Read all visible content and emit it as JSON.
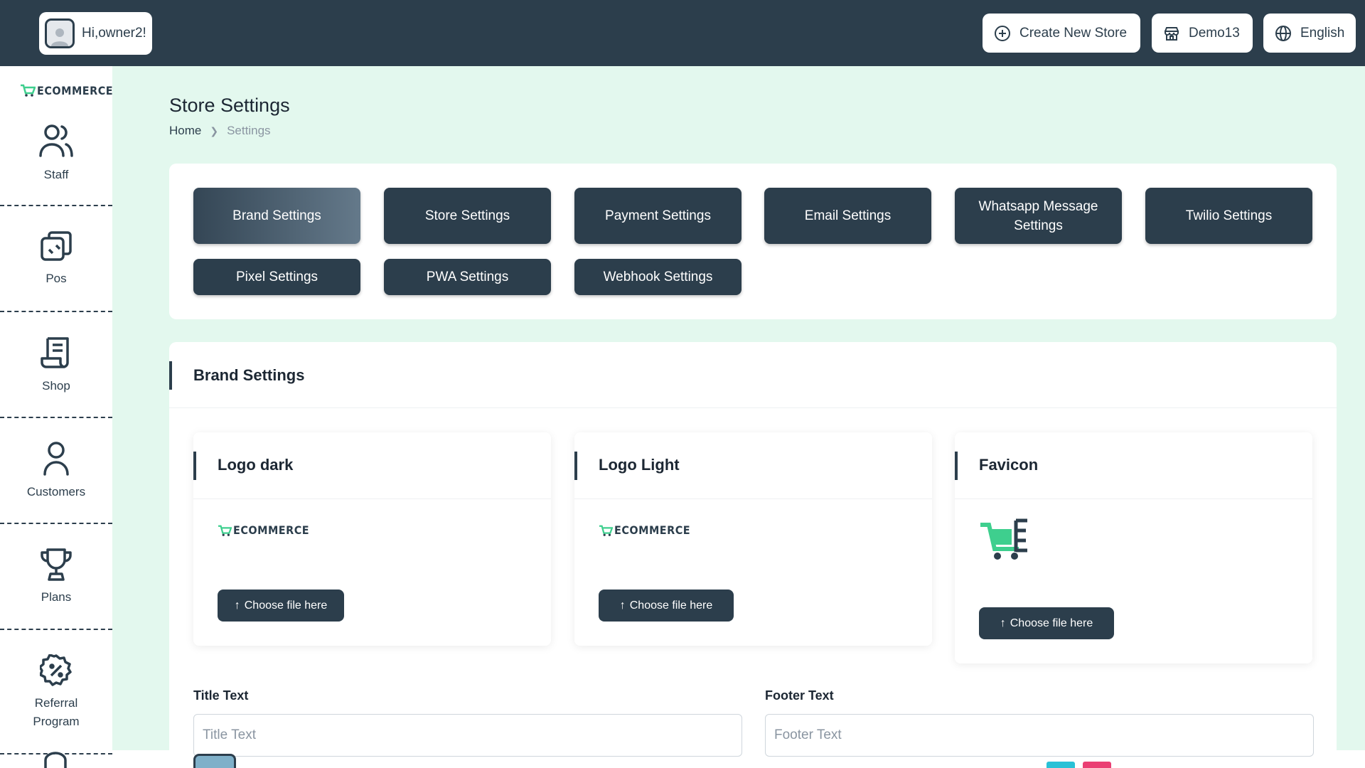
{
  "header": {
    "greeting": "Hi,owner2!",
    "create_store": "Create New Store",
    "store_name": "Demo13",
    "language": "English"
  },
  "brand": {
    "logo_text": "ECOMMERCE"
  },
  "sidebar": {
    "items": [
      {
        "label": "Staff",
        "icon": "users-icon"
      },
      {
        "label": "Pos",
        "icon": "pos-icon"
      },
      {
        "label": "Shop",
        "icon": "shop-icon"
      },
      {
        "label": "Customers",
        "icon": "customer-icon"
      },
      {
        "label": "Plans",
        "icon": "trophy-icon"
      },
      {
        "label": "Referral Program",
        "icon": "discount-badge-icon"
      }
    ]
  },
  "page": {
    "title": "Store Settings",
    "breadcrumb": {
      "home": "Home",
      "current": "Settings"
    }
  },
  "tabs": [
    {
      "label": "Brand Settings",
      "active": true
    },
    {
      "label": "Store Settings",
      "active": false
    },
    {
      "label": "Payment Settings",
      "active": false
    },
    {
      "label": "Email Settings",
      "active": false
    },
    {
      "label": "Whatsapp Message Settings",
      "active": false
    },
    {
      "label": "Twilio Settings",
      "active": false
    },
    {
      "label": "Pixel Settings",
      "active": false
    },
    {
      "label": "PWA Settings",
      "active": false
    },
    {
      "label": "Webhook Settings",
      "active": false
    }
  ],
  "brand_settings": {
    "title": "Brand Settings",
    "logo_dark": {
      "title": "Logo dark",
      "button": "Choose file here"
    },
    "logo_light": {
      "title": "Logo Light",
      "button": "Choose file here"
    },
    "favicon": {
      "title": "Favicon",
      "button": "Choose file here"
    },
    "title_text": {
      "label": "Title Text",
      "placeholder": "Title Text"
    },
    "footer_text": {
      "label": "Footer Text",
      "placeholder": "Footer Text"
    }
  },
  "colors": {
    "primary": "#2c3e4c",
    "background": "#e3f8ee",
    "accent_green": "#3ecf8e"
  }
}
